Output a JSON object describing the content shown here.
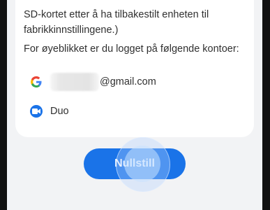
{
  "dialog": {
    "paragraph_lines": [
      "SD-kortet etter å ha tilbakestilt enheten til",
      "fabrikkinnstillingene.)"
    ],
    "accounts_header": "For øyeblikket er du logget på følgende kontoer:",
    "accounts": [
      {
        "icon": "google-icon",
        "label": "@gmail.com"
      },
      {
        "icon": "duo-icon",
        "label": "Duo"
      }
    ]
  },
  "reset_button": {
    "label": "Nullstill"
  },
  "colors": {
    "accent": "#1a73e8",
    "card": "#ffffff",
    "background": "#f2f3f5"
  }
}
